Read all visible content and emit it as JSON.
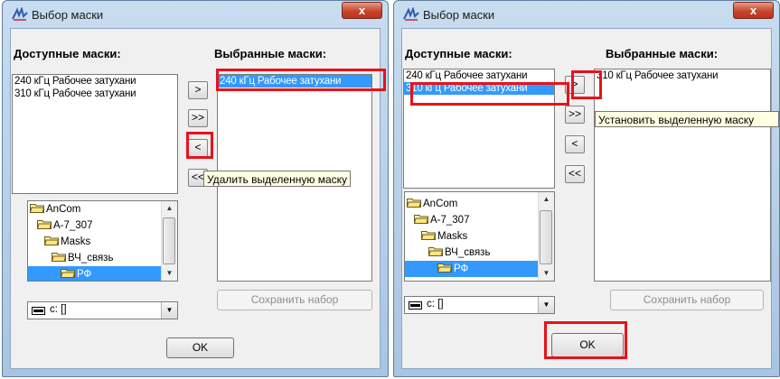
{
  "dialog_left": {
    "title": "Выбор маски",
    "close_label": "x",
    "available_label": "Доступные маски:",
    "selected_label": "Выбранные маски:",
    "available_items": [
      "240 кГц Рабочее затухани",
      "310 кГц Рабочее затухани"
    ],
    "selected_items": [
      "240 кГц Рабочее затухани"
    ],
    "btn_add": ">",
    "btn_add_all": ">>",
    "btn_remove": "<",
    "btn_remove_all": "<<",
    "tooltip": "Удалить выделенную маску",
    "tree": [
      "AnCom",
      "A-7_307",
      "Masks",
      "ВЧ_связь",
      "РФ"
    ],
    "drive": "c: []",
    "save_set": "Сохранить набор",
    "ok": "OK"
  },
  "dialog_right": {
    "title": "Выбор маски",
    "close_label": "x",
    "available_label": "Доступные маски:",
    "selected_label": "Выбранные маски:",
    "available_items": [
      "240 кГц Рабочее затухани",
      "310 кГц Рабочее затухани"
    ],
    "selected_items": [
      "310 кГц Рабочее затухани"
    ],
    "btn_add": ">",
    "btn_add_all": ">>",
    "btn_remove": "<",
    "btn_remove_all": "<<",
    "tooltip": "Установить выделенную маску",
    "tree": [
      "AnCom",
      "A-7_307",
      "Masks",
      "ВЧ_связь",
      "РФ"
    ],
    "drive": "c: []",
    "save_set": "Сохранить набор",
    "ok": "OK"
  },
  "colors": {
    "highlight": "#e8121a",
    "selection": "#3399ff",
    "tooltip_bg": "#ffffe1"
  }
}
